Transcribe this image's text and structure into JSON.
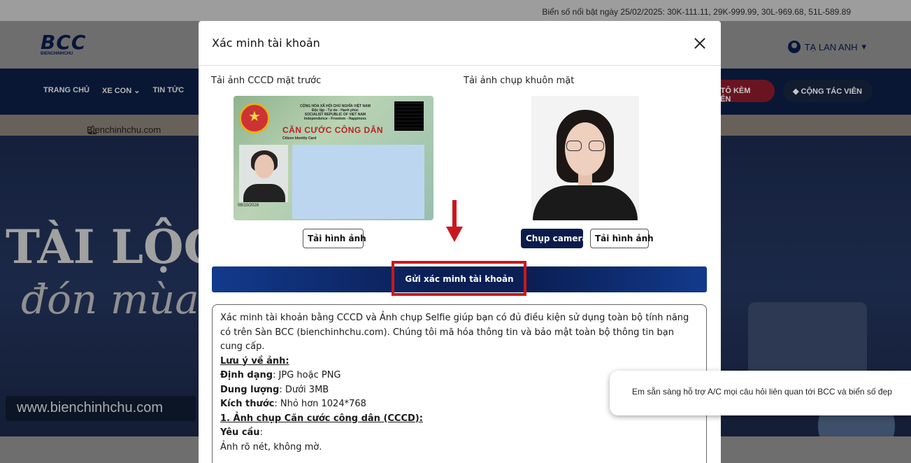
{
  "ticker": {
    "text": "Biển số nổi bật ngày 25/02/2025: 30K-111.11, 29K-999.99, 30L-969.68, 51L-589.89"
  },
  "header": {
    "logo_main": "BCC",
    "logo_sub": "BIENCHINHCHU",
    "user_name": "TẠ LAN ANH",
    "user_caret": "▾"
  },
  "nav": {
    "items": [
      "TRANG CHỦ",
      "XE CON ⌄",
      "TIN TỨC"
    ],
    "plate_button": "Ô TÔ KÈM BIỂN",
    "collab_button": "CỘNG TÁC VIÊN"
  },
  "notice": {
    "text": "Bienchinhchu.com đang chạy"
  },
  "banner": {
    "line1": "TÀI LỘC",
    "line2": "đón mùa",
    "website": "www.bienchinhchu.com"
  },
  "modal": {
    "title": "Xác minh tài khoản",
    "front_id_label": "Tải ảnh CCCD mặt trước",
    "selfie_label": "Tải ảnh chụp khuôn mặt",
    "upload_front_button": "Tải hình ảnh",
    "camera_button": "Chụp camera",
    "upload_selfie_button": "Tải hình ảnh",
    "submit_button": "Gửi xác minh tài khoản",
    "id_card": {
      "header": "CỘNG HÒA XÃ HỘI CHỦ NGHĨA VIỆT NAM\nĐộc lập - Tự do - Hạnh phúc\nSOCIALIST REPUBLIC OF VIET NAM\nIndependence - Freedom - Happiness",
      "title": "CĂN CƯỚC CÔNG DÂN",
      "subtitle": "Citizen Identity Card",
      "expiry": "06/10/2028"
    },
    "info": {
      "intro": "Xác minh tài khoản bằng CCCD và Ảnh chụp Selfie giúp bạn có đủ điều kiện sử dụng toàn bộ tính năng có trên Sàn BCC (bienchinhchu.com). Chúng tôi mã hóa thông tin và bảo mật toàn bộ thông tin bạn cung cấp.",
      "note_heading": "Lưu ý về ảnh:",
      "format_label": "Định dạng",
      "format_value": ": JPG hoặc PNG",
      "size_label": "Dung lượng",
      "size_value": ": Dưới 3MB",
      "dim_label": "Kích thước",
      "dim_value": ": Nhỏ hơn 1024*768",
      "section1": "1. Ảnh chụp Căn cước công dân (CCCD):",
      "req_label": "Yêu cầu",
      "req_colon": ":",
      "req_item": "Ảnh rõ nét, không mờ."
    }
  },
  "chat": {
    "text": "Em sẵn sàng hỗ trợ A/C mọi câu hỏi liên quan tới BCC và biển số đẹp"
  },
  "colors": {
    "accent_red": "#c8181e",
    "navy": "#0b1b4c"
  }
}
